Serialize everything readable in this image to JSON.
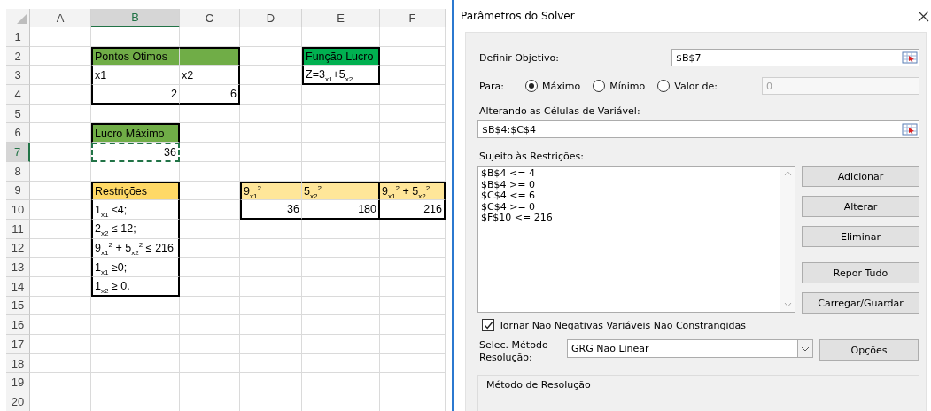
{
  "spreadsheet": {
    "columns": [
      {
        "label": "A",
        "selected": false
      },
      {
        "label": "B",
        "selected": true
      },
      {
        "label": "C",
        "selected": false
      },
      {
        "label": "D",
        "selected": false
      },
      {
        "label": "E",
        "selected": false
      },
      {
        "label": "F",
        "selected": false
      }
    ],
    "rows": [
      {
        "label": "1",
        "selected": false
      },
      {
        "label": "2",
        "selected": false,
        "cells": [
          {
            "kind": "empty"
          },
          {
            "kind": "text",
            "text": "Pontos Otimos",
            "color": "#70ad47",
            "borders": {
              "top": true,
              "left": true,
              "right": false,
              "bottom": false
            },
            "copied": false
          },
          {
            "kind": "fill",
            "color": "#70ad47",
            "borders": {
              "top": true,
              "left": false,
              "right": true,
              "bottom": false
            },
            "copied": false
          },
          {
            "kind": "empty"
          },
          {
            "kind": "text",
            "text": "Função Lucro",
            "color": "#00b050",
            "borders": {
              "top": true,
              "left": true,
              "right": true,
              "bottom": false
            },
            "copied": false
          },
          {
            "kind": "empty"
          }
        ]
      },
      {
        "label": "3",
        "selected": false,
        "cells": [
          {
            "kind": "empty"
          },
          {
            "kind": "text",
            "text": "x1",
            "borders": {
              "top": false,
              "left": true,
              "right": false,
              "bottom": false
            },
            "copied": false
          },
          {
            "kind": "text",
            "text": "x2",
            "borders": {
              "top": false,
              "left": false,
              "right": true,
              "bottom": false
            },
            "copied": false
          },
          {
            "kind": "empty"
          },
          {
            "kind": "text",
            "text": "Z=3$_{x1}$+5$_{x2}$",
            "borders": {
              "top": false,
              "left": true,
              "right": true,
              "bottom": true
            },
            "copied": false
          },
          {
            "kind": "empty"
          }
        ]
      },
      {
        "label": "4",
        "selected": false,
        "cells": [
          {
            "kind": "empty"
          },
          {
            "kind": "number",
            "text": "2",
            "borders": {
              "top": false,
              "left": true,
              "right": false,
              "bottom": true
            },
            "copied": false
          },
          {
            "kind": "number",
            "text": "6",
            "borders": {
              "top": false,
              "left": false,
              "right": true,
              "bottom": true
            },
            "copied": false
          },
          {
            "kind": "empty"
          },
          {
            "kind": "empty"
          },
          {
            "kind": "empty"
          }
        ]
      },
      {
        "label": "5",
        "selected": false
      },
      {
        "label": "6",
        "selected": false,
        "cells": [
          {
            "kind": "empty"
          },
          {
            "kind": "text",
            "text": "Lucro Máximo",
            "color": "#70ad47",
            "borders": {
              "top": true,
              "left": true,
              "right": true,
              "bottom": false
            },
            "copied": false
          },
          {
            "kind": "empty"
          },
          {
            "kind": "empty"
          },
          {
            "kind": "empty"
          },
          {
            "kind": "empty"
          }
        ]
      },
      {
        "label": "7",
        "selected": true,
        "cells": [
          {
            "kind": "empty"
          },
          {
            "kind": "number",
            "text": "36",
            "copied": true
          },
          {
            "kind": "empty"
          },
          {
            "kind": "empty"
          },
          {
            "kind": "empty"
          },
          {
            "kind": "empty"
          }
        ]
      },
      {
        "label": "8",
        "selected": false
      },
      {
        "label": "9",
        "selected": false,
        "cells": [
          {
            "kind": "empty"
          },
          {
            "kind": "text",
            "text": "Restrições",
            "color": "#ffd966",
            "borders": {
              "top": true,
              "left": true,
              "right": true,
              "bottom": false
            },
            "copied": false
          },
          {
            "kind": "empty"
          },
          {
            "kind": "text",
            "text": "9$_{x1}$$^{2}$",
            "color": "#ffe699",
            "borders": {
              "top": true,
              "left": true,
              "right": false,
              "bottom": false
            },
            "copied": false
          },
          {
            "kind": "text",
            "text": "5$_{x2}$$^{2}$",
            "color": "#ffe699",
            "borders": {
              "top": true,
              "left": false,
              "right": true,
              "bottom": false
            },
            "copied": false
          },
          {
            "kind": "text",
            "text": "9$_{x1}$$^{2}$ + 5$_{x2}$$^{2}$",
            "color": "#ffe699",
            "borders": {
              "top": true,
              "left": false,
              "right": true,
              "bottom": false
            },
            "copied": false
          }
        ]
      },
      {
        "label": "10",
        "selected": false,
        "cells": [
          {
            "kind": "empty"
          },
          {
            "kind": "text",
            "text": "1$_{x1}$ ≤4;",
            "borders": {
              "top": false,
              "left": true,
              "right": true,
              "bottom": false
            },
            "copied": false
          },
          {
            "kind": "empty"
          },
          {
            "kind": "number",
            "text": "36",
            "borders": {
              "top": false,
              "left": true,
              "right": false,
              "bottom": true
            },
            "copied": false
          },
          {
            "kind": "number",
            "text": "180",
            "borders": {
              "top": false,
              "left": false,
              "right": true,
              "bottom": true
            },
            "copied": false
          },
          {
            "kind": "number",
            "text": "216",
            "borders": {
              "top": false,
              "left": false,
              "right": true,
              "bottom": true
            },
            "copied": false
          }
        ]
      },
      {
        "label": "11",
        "selected": false,
        "cells": [
          {
            "kind": "empty"
          },
          {
            "kind": "text",
            "text": "2$_{x2}$ ≤ 12;",
            "borders": {
              "top": false,
              "left": true,
              "right": true,
              "bottom": false
            },
            "copied": false
          },
          {
            "kind": "empty"
          },
          {
            "kind": "empty"
          },
          {
            "kind": "empty"
          },
          {
            "kind": "empty"
          }
        ]
      },
      {
        "label": "12",
        "selected": false,
        "cells": [
          {
            "kind": "empty"
          },
          {
            "kind": "text",
            "text": "9$_{x1}$$^{2}$ + 5$_{x2}$$^{2}$ ≤ 216",
            "borders": {
              "top": false,
              "left": true,
              "right": true,
              "bottom": false
            },
            "copied": false
          },
          {
            "kind": "empty"
          },
          {
            "kind": "empty"
          },
          {
            "kind": "empty"
          },
          {
            "kind": "empty"
          }
        ]
      },
      {
        "label": "13",
        "selected": false,
        "cells": [
          {
            "kind": "empty"
          },
          {
            "kind": "text",
            "text": "1$_{x1}$ ≥0;",
            "borders": {
              "top": false,
              "left": true,
              "right": true,
              "bottom": false
            },
            "copied": false
          },
          {
            "kind": "empty"
          },
          {
            "kind": "empty"
          },
          {
            "kind": "empty"
          },
          {
            "kind": "empty"
          }
        ]
      },
      {
        "label": "14",
        "selected": false,
        "cells": [
          {
            "kind": "empty"
          },
          {
            "kind": "text",
            "text": "1$_{x2}$ ≥ 0.",
            "borders": {
              "top": false,
              "left": true,
              "right": true,
              "bottom": true
            },
            "copied": false
          },
          {
            "kind": "empty"
          },
          {
            "kind": "empty"
          },
          {
            "kind": "empty"
          },
          {
            "kind": "empty"
          }
        ]
      },
      {
        "label": "15",
        "selected": false
      },
      {
        "label": "16",
        "selected": false
      },
      {
        "label": "17",
        "selected": false
      },
      {
        "label": "18",
        "selected": false
      },
      {
        "label": "19",
        "selected": false
      },
      {
        "label": "20",
        "selected": false
      }
    ]
  },
  "dialog": {
    "title": "Parâmetros do Solver",
    "objective": {
      "label": "Definir Objetivo:",
      "value": "$B$7"
    },
    "to": {
      "label": "Para:",
      "options": [
        {
          "label": "Máximo",
          "selected": true
        },
        {
          "label": "Mínimo",
          "selected": false
        },
        {
          "label": "Valor de:",
          "selected": false
        }
      ],
      "value_field": {
        "value": "0",
        "disabled": true
      }
    },
    "variables": {
      "label": "Alterando as Células de Variável:",
      "value": "$B$4:$C$4"
    },
    "constraints": {
      "label": "Sujeito às Restrições:",
      "items": [
        "$B$4 <= 4",
        "$B$4 >= 0",
        "$C$4 <= 6",
        "$C$4 >= 0",
        "$F$10 <= 216"
      ]
    },
    "buttons": [
      "Adicionar",
      "Alterar",
      "Eliminar",
      "Repor Tudo",
      "Carregar/Guardar"
    ],
    "nonnegative": {
      "label": "Tornar Não Negativas Variáveis Não Constrangidas",
      "checked": true
    },
    "method": {
      "label": "Selec. Método Resolução:",
      "value": "GRG Não Linear"
    },
    "options_button": "Opções",
    "method_group": {
      "title": "Método de Resolução"
    }
  }
}
